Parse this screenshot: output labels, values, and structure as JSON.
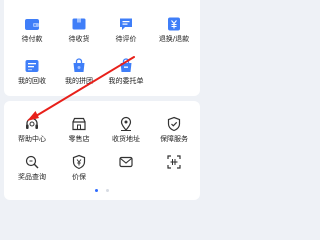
{
  "orders": {
    "items": [
      {
        "label": "待付款",
        "icon": "wallet-icon"
      },
      {
        "label": "待收货",
        "icon": "package-icon"
      },
      {
        "label": "待评价",
        "icon": "comment-icon"
      },
      {
        "label": "退换/退款",
        "icon": "refund-icon"
      },
      {
        "label": "我的回收",
        "icon": "recycle-icon"
      },
      {
        "label": "我的拼团",
        "icon": "group-buy-icon"
      },
      {
        "label": "我的委托单",
        "icon": "commission-order-icon"
      }
    ]
  },
  "services": {
    "items": [
      {
        "label": "帮助中心",
        "icon": "headset-icon"
      },
      {
        "label": "零售店",
        "icon": "store-icon"
      },
      {
        "label": "收货地址",
        "icon": "location-icon"
      },
      {
        "label": "保障服务",
        "icon": "shield-icon"
      },
      {
        "label": "奖品查询",
        "icon": "prize-search-icon"
      },
      {
        "label": "价保",
        "icon": "price-protect-icon"
      },
      {
        "label": "",
        "icon": "message-icon"
      },
      {
        "label": "",
        "icon": "scan-icon"
      }
    ],
    "carousel": {
      "pages": 2,
      "active": 1
    }
  },
  "colors": {
    "background": "#eef1f6",
    "card": "#ffffff",
    "order_icon": "#3f7ef8",
    "service_icon": "#333333",
    "annotation_arrow": "#e8201a",
    "active_dot": "#2f6bff"
  }
}
